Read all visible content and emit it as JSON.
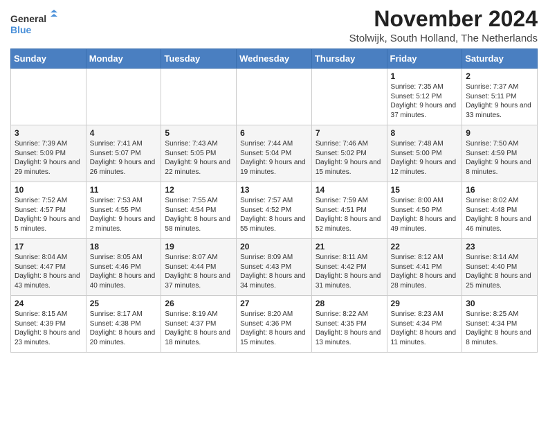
{
  "logo": {
    "line1": "General",
    "line2": "Blue"
  },
  "title": "November 2024",
  "location": "Stolwijk, South Holland, The Netherlands",
  "weekdays": [
    "Sunday",
    "Monday",
    "Tuesday",
    "Wednesday",
    "Thursday",
    "Friday",
    "Saturday"
  ],
  "weeks": [
    [
      {
        "day": "",
        "info": ""
      },
      {
        "day": "",
        "info": ""
      },
      {
        "day": "",
        "info": ""
      },
      {
        "day": "",
        "info": ""
      },
      {
        "day": "",
        "info": ""
      },
      {
        "day": "1",
        "info": "Sunrise: 7:35 AM\nSunset: 5:12 PM\nDaylight: 9 hours and 37 minutes."
      },
      {
        "day": "2",
        "info": "Sunrise: 7:37 AM\nSunset: 5:11 PM\nDaylight: 9 hours and 33 minutes."
      }
    ],
    [
      {
        "day": "3",
        "info": "Sunrise: 7:39 AM\nSunset: 5:09 PM\nDaylight: 9 hours and 29 minutes."
      },
      {
        "day": "4",
        "info": "Sunrise: 7:41 AM\nSunset: 5:07 PM\nDaylight: 9 hours and 26 minutes."
      },
      {
        "day": "5",
        "info": "Sunrise: 7:43 AM\nSunset: 5:05 PM\nDaylight: 9 hours and 22 minutes."
      },
      {
        "day": "6",
        "info": "Sunrise: 7:44 AM\nSunset: 5:04 PM\nDaylight: 9 hours and 19 minutes."
      },
      {
        "day": "7",
        "info": "Sunrise: 7:46 AM\nSunset: 5:02 PM\nDaylight: 9 hours and 15 minutes."
      },
      {
        "day": "8",
        "info": "Sunrise: 7:48 AM\nSunset: 5:00 PM\nDaylight: 9 hours and 12 minutes."
      },
      {
        "day": "9",
        "info": "Sunrise: 7:50 AM\nSunset: 4:59 PM\nDaylight: 9 hours and 8 minutes."
      }
    ],
    [
      {
        "day": "10",
        "info": "Sunrise: 7:52 AM\nSunset: 4:57 PM\nDaylight: 9 hours and 5 minutes."
      },
      {
        "day": "11",
        "info": "Sunrise: 7:53 AM\nSunset: 4:55 PM\nDaylight: 9 hours and 2 minutes."
      },
      {
        "day": "12",
        "info": "Sunrise: 7:55 AM\nSunset: 4:54 PM\nDaylight: 8 hours and 58 minutes."
      },
      {
        "day": "13",
        "info": "Sunrise: 7:57 AM\nSunset: 4:52 PM\nDaylight: 8 hours and 55 minutes."
      },
      {
        "day": "14",
        "info": "Sunrise: 7:59 AM\nSunset: 4:51 PM\nDaylight: 8 hours and 52 minutes."
      },
      {
        "day": "15",
        "info": "Sunrise: 8:00 AM\nSunset: 4:50 PM\nDaylight: 8 hours and 49 minutes."
      },
      {
        "day": "16",
        "info": "Sunrise: 8:02 AM\nSunset: 4:48 PM\nDaylight: 8 hours and 46 minutes."
      }
    ],
    [
      {
        "day": "17",
        "info": "Sunrise: 8:04 AM\nSunset: 4:47 PM\nDaylight: 8 hours and 43 minutes."
      },
      {
        "day": "18",
        "info": "Sunrise: 8:05 AM\nSunset: 4:46 PM\nDaylight: 8 hours and 40 minutes."
      },
      {
        "day": "19",
        "info": "Sunrise: 8:07 AM\nSunset: 4:44 PM\nDaylight: 8 hours and 37 minutes."
      },
      {
        "day": "20",
        "info": "Sunrise: 8:09 AM\nSunset: 4:43 PM\nDaylight: 8 hours and 34 minutes."
      },
      {
        "day": "21",
        "info": "Sunrise: 8:11 AM\nSunset: 4:42 PM\nDaylight: 8 hours and 31 minutes."
      },
      {
        "day": "22",
        "info": "Sunrise: 8:12 AM\nSunset: 4:41 PM\nDaylight: 8 hours and 28 minutes."
      },
      {
        "day": "23",
        "info": "Sunrise: 8:14 AM\nSunset: 4:40 PM\nDaylight: 8 hours and 25 minutes."
      }
    ],
    [
      {
        "day": "24",
        "info": "Sunrise: 8:15 AM\nSunset: 4:39 PM\nDaylight: 8 hours and 23 minutes."
      },
      {
        "day": "25",
        "info": "Sunrise: 8:17 AM\nSunset: 4:38 PM\nDaylight: 8 hours and 20 minutes."
      },
      {
        "day": "26",
        "info": "Sunrise: 8:19 AM\nSunset: 4:37 PM\nDaylight: 8 hours and 18 minutes."
      },
      {
        "day": "27",
        "info": "Sunrise: 8:20 AM\nSunset: 4:36 PM\nDaylight: 8 hours and 15 minutes."
      },
      {
        "day": "28",
        "info": "Sunrise: 8:22 AM\nSunset: 4:35 PM\nDaylight: 8 hours and 13 minutes."
      },
      {
        "day": "29",
        "info": "Sunrise: 8:23 AM\nSunset: 4:34 PM\nDaylight: 8 hours and 11 minutes."
      },
      {
        "day": "30",
        "info": "Sunrise: 8:25 AM\nSunset: 4:34 PM\nDaylight: 8 hours and 8 minutes."
      }
    ]
  ]
}
